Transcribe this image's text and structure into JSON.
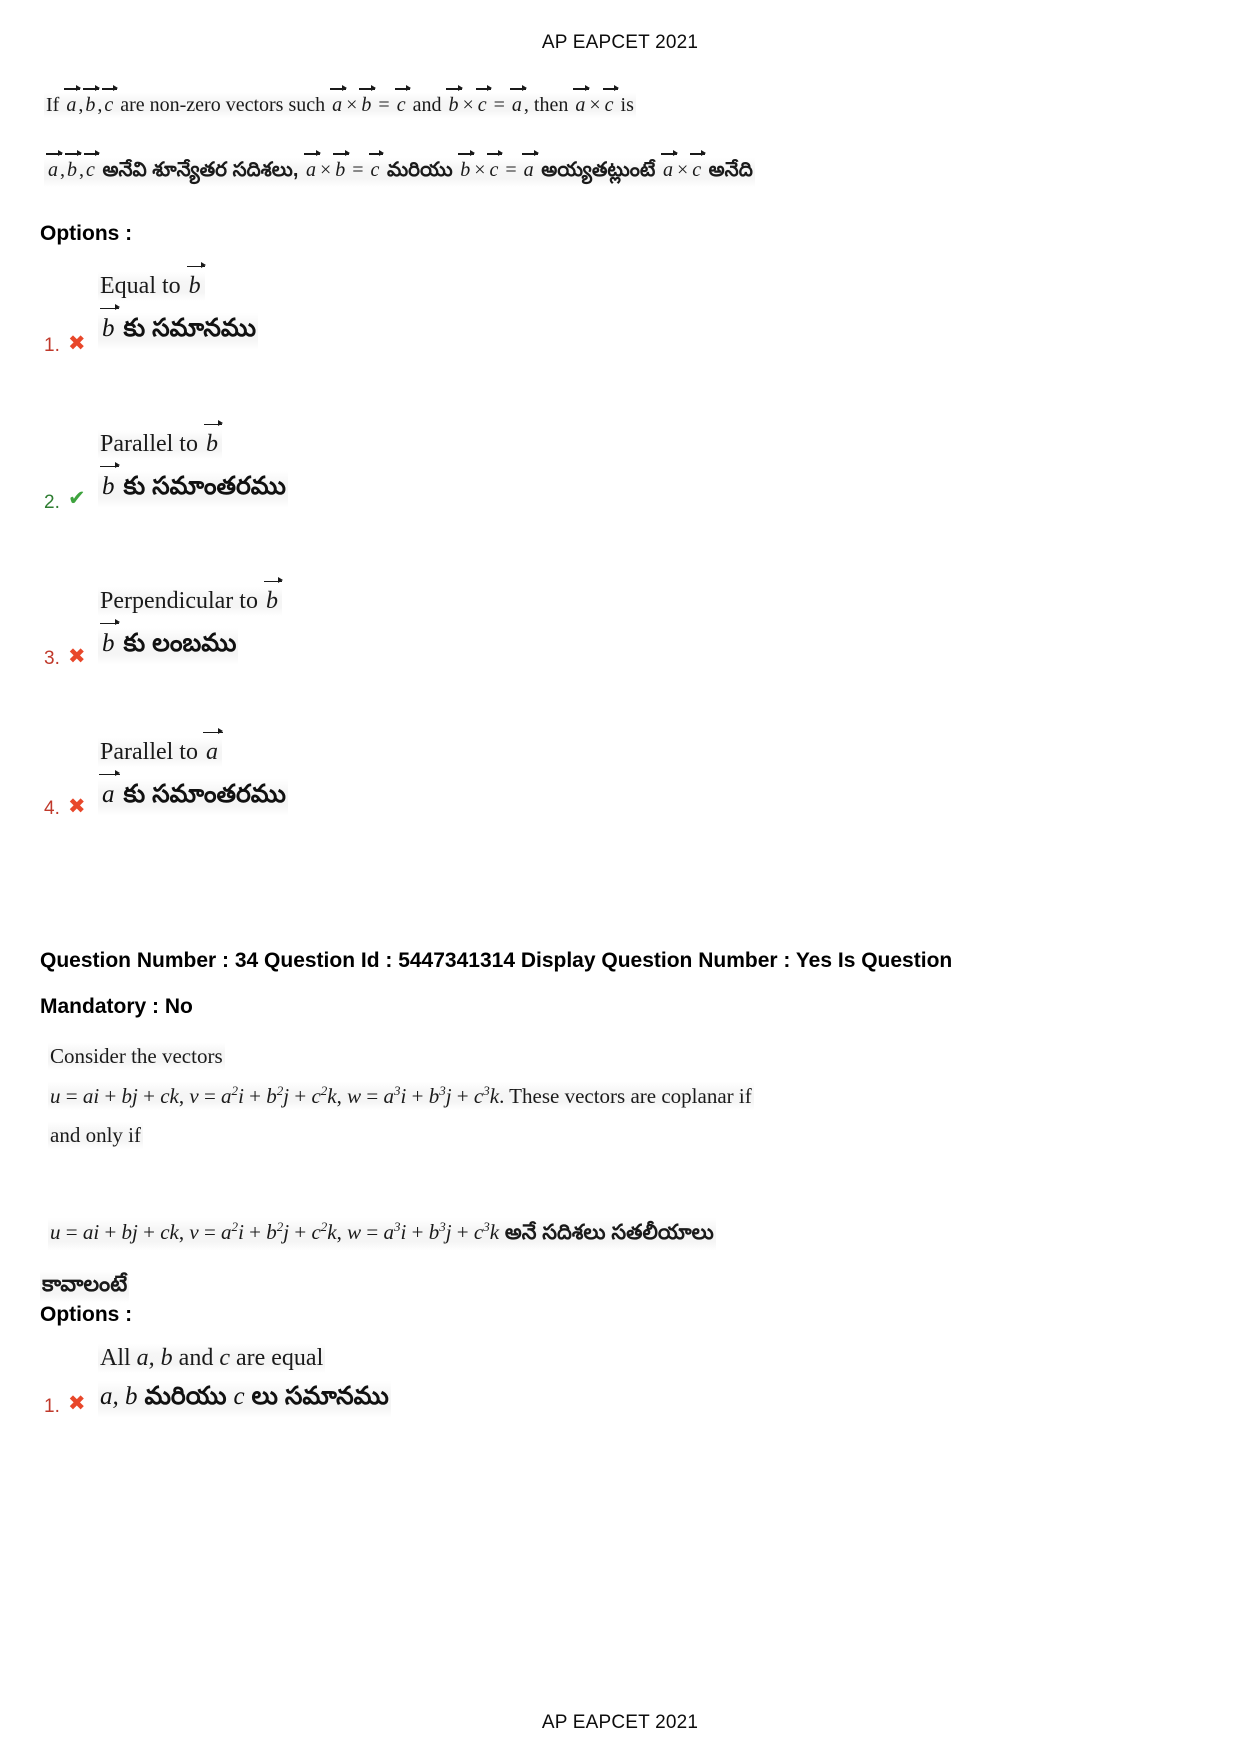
{
  "document": {
    "header_top": "AP EAPCET 2021",
    "footer_bottom": "AP EAPCET 2021"
  },
  "question_33": {
    "stem_en": {
      "p1": "If ",
      "v_a1": "a",
      "c1": ",",
      "v_b1": "b",
      "c2": ",",
      "v_c1": "c",
      "p2": " are non-zero vectors such ",
      "v_a2": "a",
      "times1": "×",
      "v_b2": "b",
      "eq1": " = ",
      "v_c2": "c",
      "p3": " and ",
      "v_b3": "b",
      "times2": "×",
      "v_c3": "c",
      "eq2": " = ",
      "v_a3": "a",
      "p4": ", then ",
      "v_a4": "a",
      "times3": "×",
      "v_c4": "c",
      "p5": " is"
    },
    "stem_te": {
      "v_a1": "a",
      "c1": ",",
      "v_b1": "b",
      "c2": ",",
      "v_c1": "c",
      "t1": " అనేవి శూన్యేతర సదిశలు, ",
      "v_a2": "a",
      "times1": "×",
      "v_b2": "b",
      "eq1": " = ",
      "v_c2": "c",
      "t2": " మరియు ",
      "v_b3": "b",
      "times2": "×",
      "v_c3": "c",
      "eq2": " = ",
      "v_a3": "a",
      "t3": " అయ్యతట్లుంటే ",
      "v_a4": "a",
      "times3": "×",
      "v_c4": "c",
      "t4": " అనేది"
    },
    "options_label": "Options :",
    "options": [
      {
        "number": "1.",
        "mark": "✖",
        "mark_kind": "cross",
        "en_prefix": "Equal to ",
        "en_vec": "b",
        "te_vec": "b",
        "te_text": " కు సమానము",
        "correct": false
      },
      {
        "number": "2.",
        "mark": "✔",
        "mark_kind": "check",
        "en_prefix": "Parallel to ",
        "en_vec": "b",
        "te_vec": "b",
        "te_text": " కు సమాంతరము",
        "correct": true
      },
      {
        "number": "3.",
        "mark": "✖",
        "mark_kind": "cross",
        "en_prefix": "Perpendicular to ",
        "en_vec": "b",
        "te_vec": "b",
        "te_text": " కు లంబము",
        "correct": false
      },
      {
        "number": "4.",
        "mark": "✖",
        "mark_kind": "cross",
        "en_prefix": "Parallel to ",
        "en_vec": "a",
        "te_vec": "a",
        "te_text": " కు సమాంతరము",
        "correct": false
      }
    ]
  },
  "question_34": {
    "meta_line_1": "Question Number : 34 Question Id : 5447341314 Display Question Number : Yes Is Question",
    "meta_line_2": "Mandatory : No",
    "question_number": "34",
    "question_id": "5447341314",
    "display_question_number": "Yes",
    "is_question_mandatory": "No",
    "stem_en_line1": "Consider the vectors",
    "stem_en_line2": {
      "u": "u",
      "eq": " = ",
      "ai": "ai",
      "plus1": " + ",
      "bj": "bj",
      "plus2": " + ",
      "ck": "ck",
      "comma1": ", ",
      "v": "v",
      "eq2": " = ",
      "a2i": "a",
      "sup2a": "2",
      "i": "i",
      "plus3": " + ",
      "b2j": "b",
      "sup2b": "2",
      "j": "j",
      "plus4": " + ",
      "c2k": "c",
      "sup2c": "2",
      "k": "k",
      "comma2": ", ",
      "w": "w",
      "eq3": " = ",
      "a3i": "a",
      "sup3a": "3",
      "i2": "i",
      "plus5": " + ",
      "b3j": "b",
      "sup3b": "3",
      "j2": "j",
      "plus6": " + ",
      "c3k": "c",
      "sup3c": "3",
      "k2": "k",
      "tail": ". These vectors are coplanar if"
    },
    "stem_en_line3": "and only if",
    "stem_te_tail": " అనే సదిశలు సతలీయాలు",
    "stem_te_line2": "కావాలంటే",
    "options_label": "Options :",
    "options": [
      {
        "number": "1.",
        "mark": "✖",
        "mark_kind": "cross",
        "en_a": "All ",
        "en_vars": "a, b",
        "en_mid": " and ",
        "en_c": "c",
        "en_tail": " are equal",
        "te_vars": "a, b",
        "te_mid": " మరియు ",
        "te_c": "c",
        "te_tail": " లు సమానము",
        "correct": false
      }
    ]
  },
  "colors": {
    "cross": "#e8472a",
    "check": "#3ea33e",
    "option_number_wrong": "#c0392b",
    "option_number_right": "#2e7d32",
    "text": "#111111"
  }
}
